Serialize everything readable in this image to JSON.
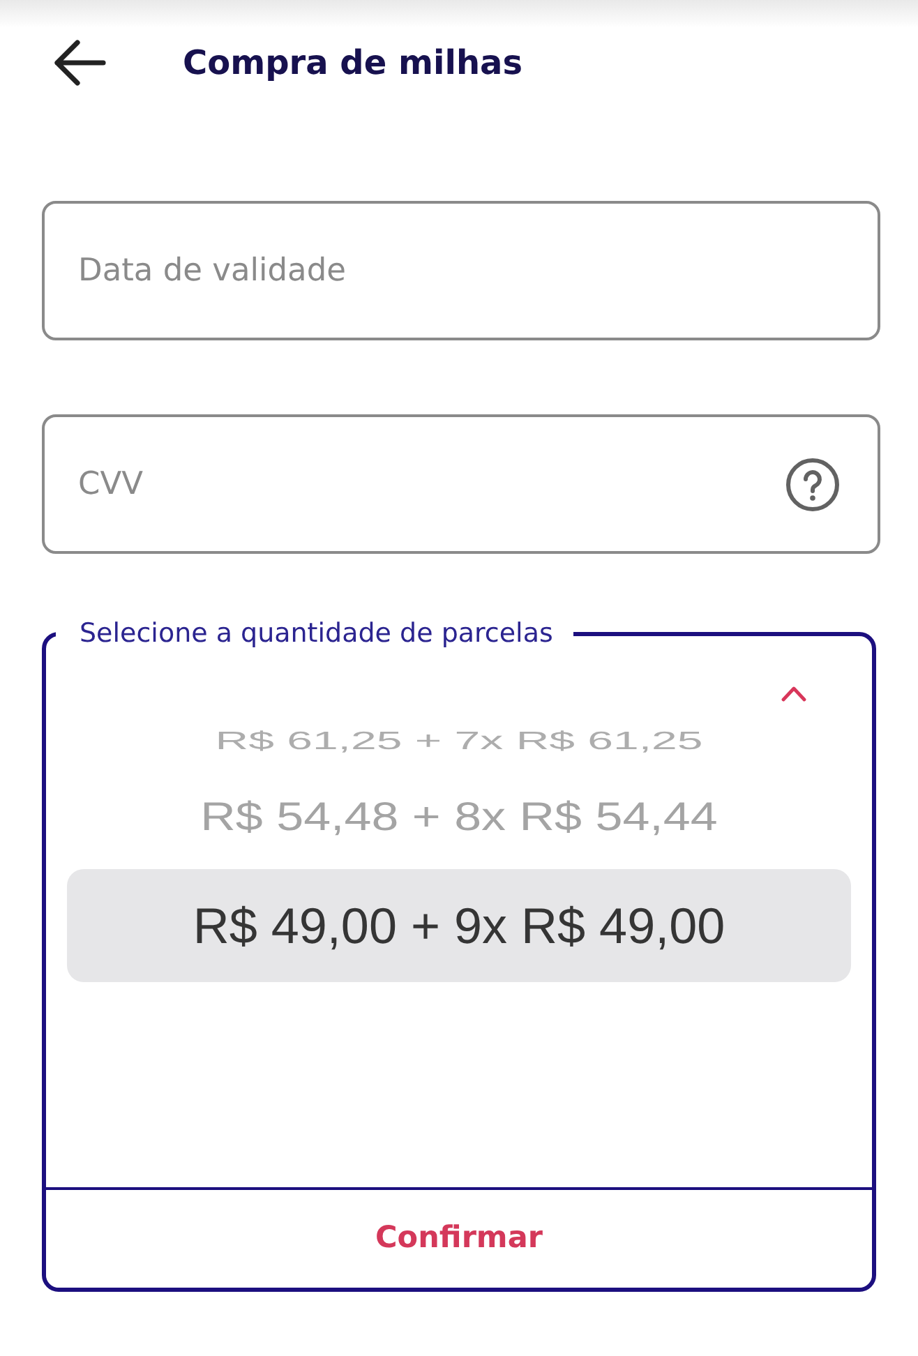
{
  "header": {
    "title": "Compra de milhas"
  },
  "fields": [
    {
      "kind": "text",
      "placeholder": "Data de validade"
    },
    {
      "kind": "help",
      "placeholder": "CVV"
    }
  ],
  "installments": {
    "label": "Selecione a quantidade de parcelas",
    "options": [
      {
        "label": "R$ 61,25 + 7x R$ 61,25",
        "selected": false
      },
      {
        "label": "R$ 54,48 + 8x R$ 54,44",
        "selected": false
      },
      {
        "label": "R$ 49,00 + 9x R$ 49,00",
        "selected": true
      }
    ],
    "confirm_button": "Confirmar"
  }
}
